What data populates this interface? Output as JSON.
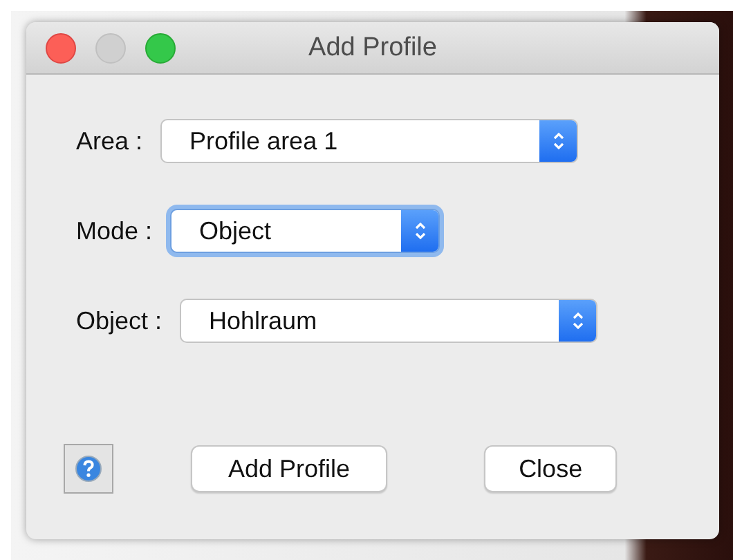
{
  "window": {
    "title": "Add Profile"
  },
  "fields": [
    {
      "label": "Area :",
      "value": "Profile area 1",
      "focused": false
    },
    {
      "label": "Mode :",
      "value": "Object",
      "focused": true
    },
    {
      "label": "Object :",
      "value": "Hohlraum",
      "focused": false
    }
  ],
  "buttons": [
    {
      "label": "Add Profile"
    },
    {
      "label": "Close"
    }
  ]
}
